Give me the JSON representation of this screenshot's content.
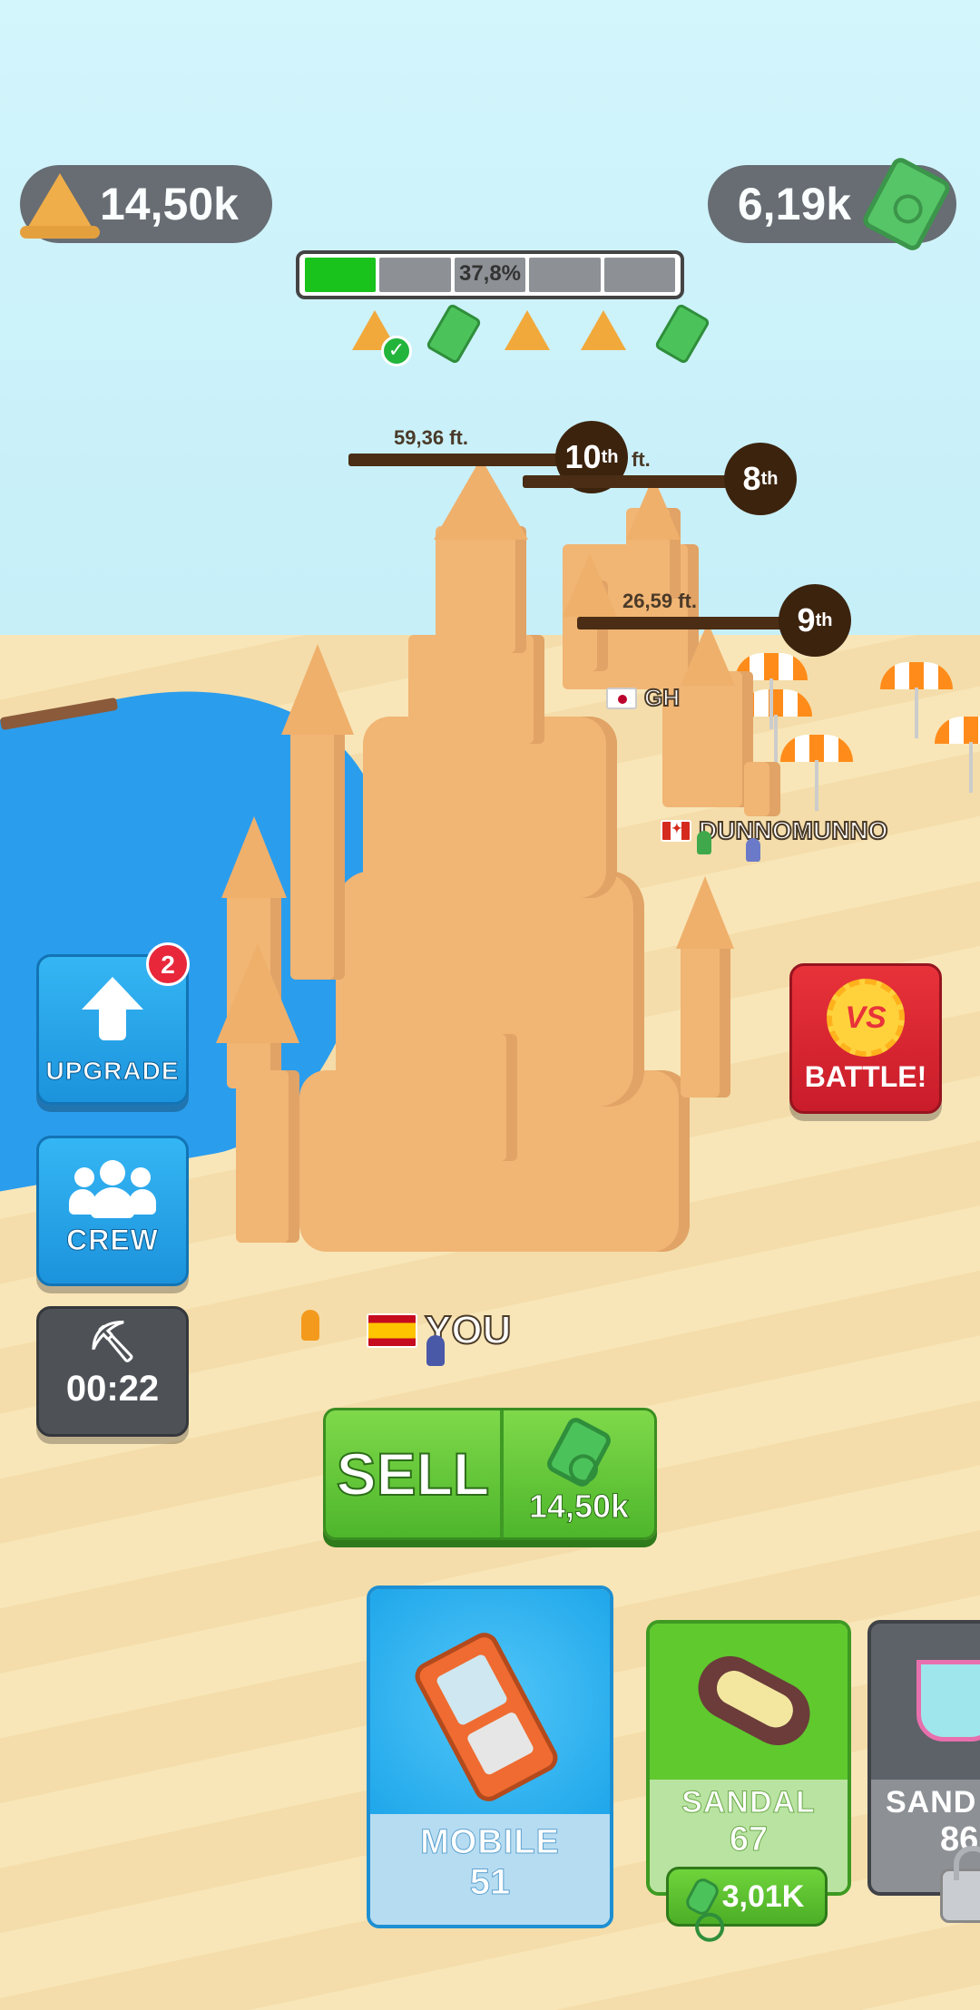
{
  "hud": {
    "sand_amount": "14,50k",
    "cash_amount": "6,19k",
    "progress": {
      "percent_label": "37,8%",
      "fraction": 0.378
    },
    "milestones": [
      "sand",
      "cash",
      "sand",
      "sand",
      "cash"
    ]
  },
  "leaderboard": [
    {
      "rank": "10",
      "suffix": "th",
      "height": "59,36 ft."
    },
    {
      "rank": "8",
      "suffix": "th",
      "height": "ft."
    },
    {
      "rank": "9",
      "suffix": "th",
      "height": "26,59 ft."
    }
  ],
  "players": {
    "you": "YOU",
    "other1": "DUNNOMUNNO",
    "other2": "GH"
  },
  "side_buttons": {
    "upgrade_label": "UPGRADE",
    "upgrade_badge": "2",
    "crew_label": "CREW",
    "timer": "00:22"
  },
  "battle": {
    "label": "BATTLE!",
    "vs": "VS"
  },
  "sell": {
    "label": "SELL",
    "amount": "14,50k"
  },
  "cards": [
    {
      "name": "MOBILE",
      "value": "51",
      "color": "#23b0f0"
    },
    {
      "name": "SANDAL",
      "value": "67",
      "price": "3,01K",
      "color": "#5cc52d"
    },
    {
      "name": "SAND",
      "value": "86",
      "color": "#5d6168"
    }
  ]
}
